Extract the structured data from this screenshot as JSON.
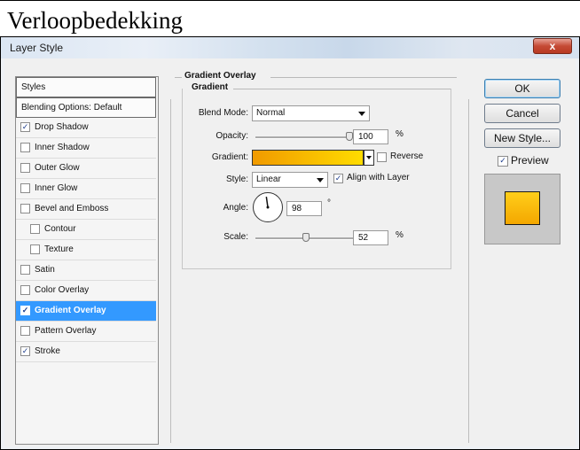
{
  "doc": {
    "title": "Verloopbedekking"
  },
  "window": {
    "title": "Layer Style",
    "close_glyph": "x"
  },
  "styles_list": [
    {
      "label": "Styles",
      "kind": "header"
    },
    {
      "label": "Blending Options: Default",
      "kind": "header"
    },
    {
      "label": "Drop Shadow",
      "checked": true
    },
    {
      "label": "Inner Shadow",
      "checked": false
    },
    {
      "label": "Outer Glow",
      "checked": false
    },
    {
      "label": "Inner Glow",
      "checked": false
    },
    {
      "label": "Bevel and Emboss",
      "checked": false
    },
    {
      "label": "Contour",
      "checked": false,
      "indent": true
    },
    {
      "label": "Texture",
      "checked": false,
      "indent": true
    },
    {
      "label": "Satin",
      "checked": false
    },
    {
      "label": "Color Overlay",
      "checked": false
    },
    {
      "label": "Gradient Overlay",
      "checked": true,
      "selected": true
    },
    {
      "label": "Pattern Overlay",
      "checked": false
    },
    {
      "label": "Stroke",
      "checked": true
    }
  ],
  "panel": {
    "title": "Gradient Overlay",
    "group": "Gradient",
    "blend_mode_label": "Blend Mode:",
    "blend_mode_value": "Normal",
    "opacity_label": "Opacity:",
    "opacity_value": "100",
    "opacity_fraction": 1.0,
    "opacity_unit": "%",
    "gradient_label": "Gradient:",
    "gradient_colors": [
      "#f19a00",
      "#ffdc00"
    ],
    "reverse_label": "Reverse",
    "reverse_checked": false,
    "style_label": "Style:",
    "style_value": "Linear",
    "align_label": "Align with Layer",
    "align_checked": true,
    "angle_label": "Angle:",
    "angle_value": "98",
    "angle_unit": "°",
    "scale_label": "Scale:",
    "scale_value": "52",
    "scale_fraction": 0.52,
    "scale_unit": "%"
  },
  "buttons": {
    "ok": "OK",
    "cancel": "Cancel",
    "new_style": "New Style...",
    "preview_label": "Preview",
    "preview_checked": true
  },
  "check_glyph": "✓"
}
